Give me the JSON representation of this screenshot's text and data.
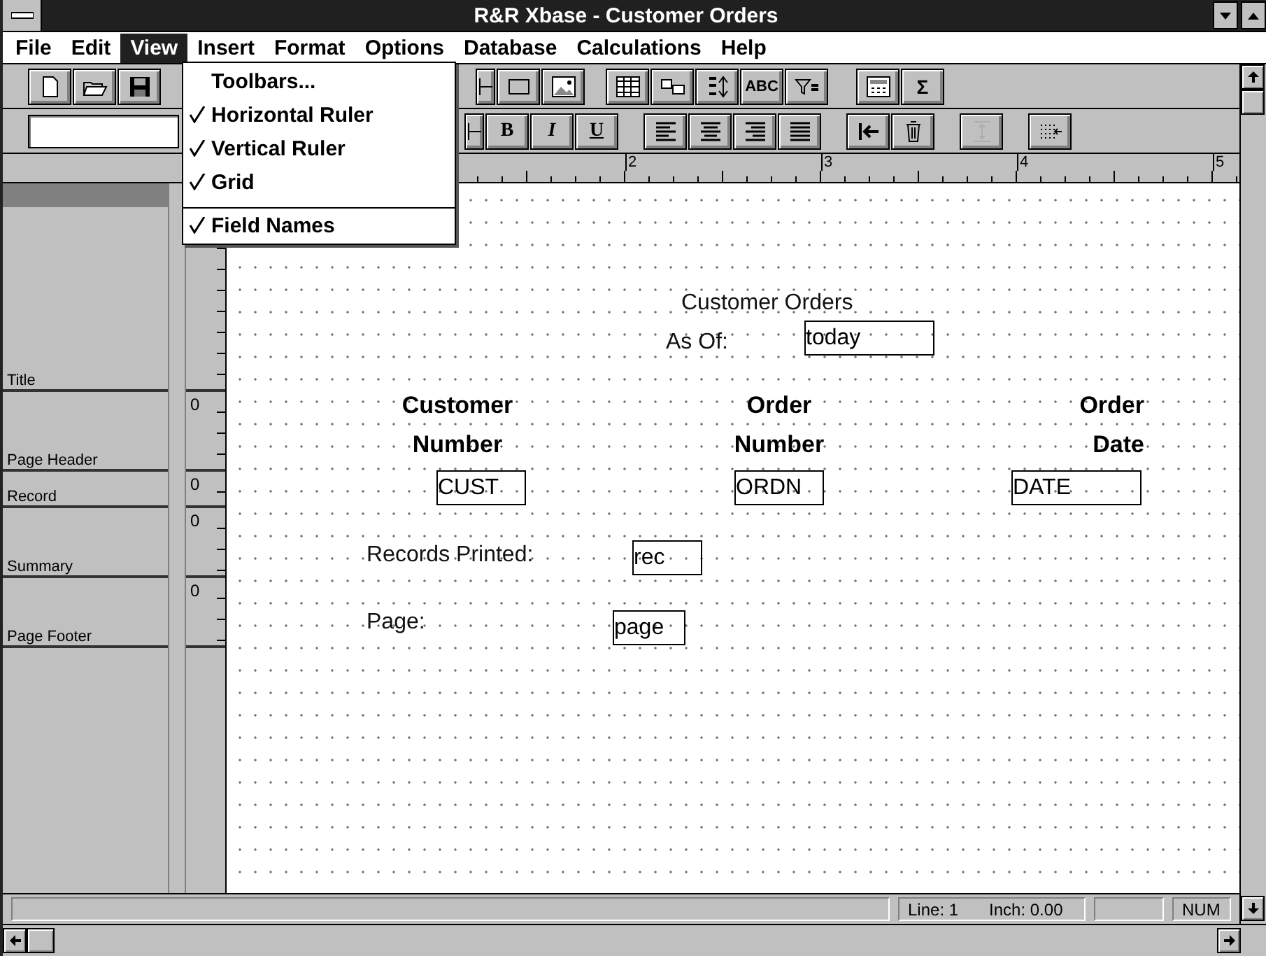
{
  "window": {
    "title": "R&R Xbase - Customer Orders"
  },
  "menu_bar": [
    {
      "label": "File",
      "selected": false
    },
    {
      "label": "Edit",
      "selected": false
    },
    {
      "label": "View",
      "selected": true
    },
    {
      "label": "Insert",
      "selected": false
    },
    {
      "label": "Format",
      "selected": false
    },
    {
      "label": "Options",
      "selected": false
    },
    {
      "label": "Database",
      "selected": false
    },
    {
      "label": "Calculations",
      "selected": false
    },
    {
      "label": "Help",
      "selected": false
    }
  ],
  "view_menu": {
    "items": [
      {
        "label": "Toolbars...",
        "checked": false,
        "separator_before": false
      },
      {
        "label": "Horizontal Ruler",
        "checked": true,
        "separator_before": false
      },
      {
        "label": "Vertical Ruler",
        "checked": true,
        "separator_before": false
      },
      {
        "label": "Grid",
        "checked": true,
        "separator_before": false
      },
      {
        "label": "Field Names",
        "checked": true,
        "separator_before": true
      }
    ]
  },
  "toolbars": [
    {
      "groups": [
        [
          {
            "kind": "new",
            "disabled": false
          },
          {
            "kind": "open",
            "disabled": false
          },
          {
            "kind": "save",
            "disabled": false
          }
        ],
        [
          {
            "kind": "partial",
            "disabled": false
          },
          {
            "kind": "rectangle",
            "disabled": false
          },
          {
            "kind": "picture",
            "disabled": false
          }
        ],
        [
          {
            "kind": "table",
            "disabled": false
          },
          {
            "kind": "field",
            "disabled": false
          },
          {
            "kind": "sort",
            "disabled": false
          },
          {
            "kind": "text",
            "label": "ABC",
            "disabled": false
          },
          {
            "kind": "filter",
            "disabled": false
          }
        ],
        [
          {
            "kind": "calculator",
            "disabled": false
          },
          {
            "kind": "text",
            "label": "Σ",
            "disabled": false
          }
        ]
      ]
    },
    {
      "groups": [
        [
          {
            "kind": "font-field"
          }
        ],
        [
          {
            "kind": "partial",
            "disabled": false
          },
          {
            "kind": "text",
            "label": "B",
            "disabled": false
          },
          {
            "kind": "text",
            "label": "I",
            "disabled": false
          },
          {
            "kind": "text",
            "label": "U",
            "disabled": false
          }
        ],
        [
          {
            "kind": "align-left",
            "disabled": false
          },
          {
            "kind": "align-center",
            "disabled": false
          },
          {
            "kind": "align-right",
            "disabled": false
          },
          {
            "kind": "justify",
            "disabled": false
          }
        ],
        [
          {
            "kind": "indent",
            "disabled": false
          },
          {
            "kind": "trash",
            "disabled": false
          }
        ],
        [
          {
            "kind": "spacing",
            "disabled": true
          }
        ],
        [
          {
            "kind": "grid",
            "disabled": false
          }
        ]
      ]
    }
  ],
  "ruler": {
    "labels": [
      "2",
      "3",
      "4",
      "5"
    ]
  },
  "bands": [
    {
      "name": "Title"
    },
    {
      "name": "Page Header",
      "ruler_mark": "0"
    },
    {
      "name": "Record",
      "ruler_mark": "0"
    },
    {
      "name": "Summary",
      "ruler_mark": "0"
    },
    {
      "name": "Page Footer",
      "ruler_mark": "0"
    }
  ],
  "report_items": [
    {
      "kind": "text",
      "text": "Customer Orders"
    },
    {
      "kind": "text",
      "text": "As Of:"
    },
    {
      "kind": "field",
      "text": "today"
    },
    {
      "kind": "heading",
      "text": "Customer\nNumber"
    },
    {
      "kind": "heading",
      "text": "Order\nNumber"
    },
    {
      "kind": "heading",
      "text": "Order\nDate"
    },
    {
      "kind": "field",
      "text": "CUST"
    },
    {
      "kind": "field",
      "text": "ORDN"
    },
    {
      "kind": "field",
      "text": "DATE"
    },
    {
      "kind": "text",
      "text": "Records Printed:"
    },
    {
      "kind": "field",
      "text": "rec"
    },
    {
      "kind": "text",
      "text": "Page:"
    },
    {
      "kind": "field",
      "text": "page"
    }
  ],
  "status_bar": {
    "line": "Line: 1",
    "inch": "Inch: 0.00",
    "mode": "NUM"
  }
}
